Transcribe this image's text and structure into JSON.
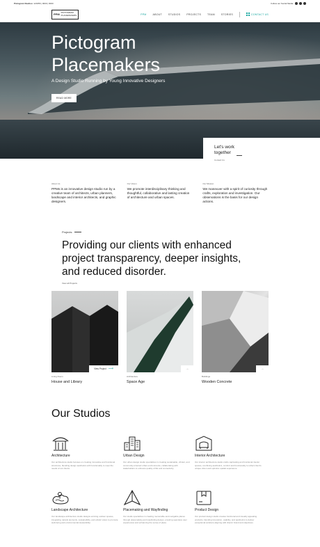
{
  "topbar": {
    "prefix": "Pictogram Studios:",
    "contact": "123456 | 0000 | 0000",
    "follow": "Follow our Social Media:"
  },
  "nav": {
    "logo_mark": "PPM",
    "logo_name_1": "PICTOGRAM",
    "logo_name_2": "PLACEMAKERS",
    "items": [
      "PPM",
      "ABOUT",
      "STUDIOS",
      "PROJECTS",
      "TEAM",
      "STORIES"
    ],
    "contact": "CONTACT US"
  },
  "hero": {
    "title_line1": "Pictogram",
    "title_line2": "Placemakers",
    "subtitle": "A Design Studio Running by Young Innovative Designers",
    "button": "READ MORE",
    "work_title": "Let's work together",
    "work_link": "Contact Us"
  },
  "about": [
    {
      "label": "About Us",
      "text": "PPMs is an innovative design studio run by a creative team of architects, urban planners, landscape and interior architects, and graphic designers."
    },
    {
      "label": "Our Vision",
      "text": "We promote interdisciplinary thinking and thoughtful, collaborative and lasting creation of architecture and urban spaces."
    },
    {
      "label": "Our Mission",
      "text": "We maneuver with a spirit of curiosity through crafts, exploration and investigation. Our observations is the basis for our design actions."
    }
  ],
  "projects": {
    "label": "Projects",
    "title": "Providing our clients with enhanced project transparency, deeper insights, and reduced disorder.",
    "view_all": "View all Projects",
    "items": [
      {
        "category": "Living Room",
        "name": "House and Library",
        "action": "View Project"
      },
      {
        "category": "Architecture",
        "name": "Space Age",
        "action": ""
      },
      {
        "category": "Buildings",
        "name": "Wooden Concrete",
        "action": ""
      }
    ]
  },
  "studios": {
    "title": "Our Studios",
    "items": [
      {
        "name": "Architecture",
        "icon": "pavilion-icon",
        "desc": "Our architecture studio focuses on creating innovative and functional structures, blending design aesthetics with functionality to meet the needs of our clients."
      },
      {
        "name": "Urban Design",
        "icon": "city-buildings-icon",
        "desc": "Our urban design studio specializes in creating sustainable, vibrant, and community-oriented urban environments, collaborating with stakeholders to enhance quality of life and connectivity."
      },
      {
        "name": "Interior Architecture",
        "icon": "armchair-frame-icon",
        "desc": "Our interior architecture studio crafts captivating and functional interior spaces, combining aesthetics, comfort and functionality to reflect client's unique vision and optimize spatial experience."
      },
      {
        "name": "Landscape Architecture",
        "icon": "landscape-island-icon",
        "desc": "Our landscape architecture studio designs enticing outdoor spaces, integrating natural elements, sustainability, and artistic vision to promote well-being and environmental stewardship."
      },
      {
        "name": "Placemaking and Wayfinding",
        "icon": "folded-map-icon",
        "desc": "Our studio specializes in creating memorable and navigable places through placemaking and wayfinding design, ensuring seamless user experiences and enhancing the sense of place."
      },
      {
        "name": "Product Design",
        "icon": "package-box-icon",
        "desc": "Our product design studio creates functional and visually appealing products, blending innovation, usability, and aesthetics to deliver exceptional solutions aligning with clients' brand and objectives."
      }
    ]
  },
  "colors": {
    "accent": "#19a7a1",
    "text": "#222222"
  }
}
